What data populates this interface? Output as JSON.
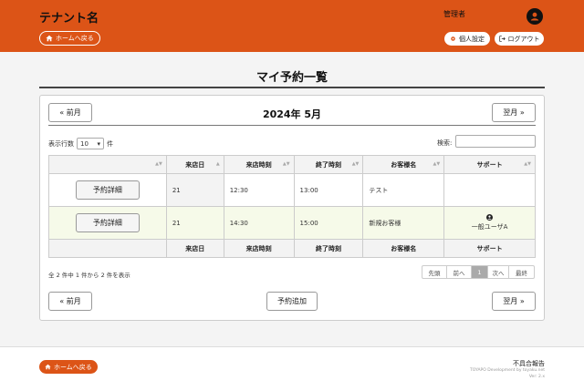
{
  "header": {
    "tenant_name": "テナント名",
    "home_label": "ホームへ戻る",
    "user_name": "管理者",
    "personal_settings_label": "個人設定",
    "logout_label": "ログアウト",
    "accent_color": "#dc5417"
  },
  "page": {
    "title": "マイ予約一覧"
  },
  "calendar": {
    "prev_label": "« 前月",
    "next_label": "翌月 »",
    "month_heading": "2024年 5月",
    "add_label": "予約追加"
  },
  "controls": {
    "show_rows_label": "表示行数",
    "rows_value": "10",
    "rows_unit": "件",
    "search_label": "検索:"
  },
  "table": {
    "columns": [
      "来店日",
      "来店時刻",
      "終了時刻",
      "お客様名",
      "サポート"
    ],
    "detail_label": "予約詳細",
    "rows": [
      {
        "day": "21",
        "start": "12:30",
        "end": "13:00",
        "customer": "テスト",
        "support": ""
      },
      {
        "day": "21",
        "start": "14:30",
        "end": "15:00",
        "customer": "新規お客様",
        "support": "一般ユーザA"
      }
    ],
    "info_text": "全 2 件中 1 件から 2 件を表示"
  },
  "pagination": {
    "first": "先頭",
    "prev": "前へ",
    "current": "1",
    "next": "次へ",
    "last": "最終"
  },
  "footer": {
    "home_label": "ホームへ戻る",
    "bug_report": "不具合報告",
    "credit": "TOYAPO Development by toyaku.net",
    "version": "Ver: 2.x"
  }
}
